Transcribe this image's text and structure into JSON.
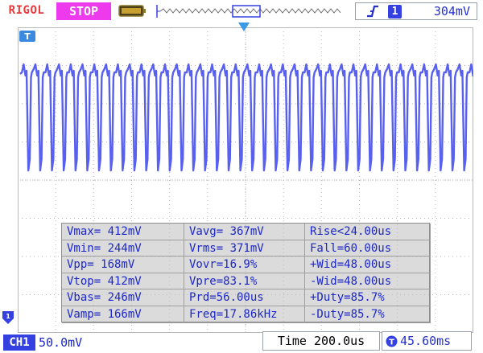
{
  "header": {
    "brand": "RIGOL",
    "run_state": "STOP"
  },
  "trigger": {
    "edge_icon": "rising-edge-icon",
    "source": "1",
    "level": "304mV"
  },
  "colors": {
    "channel": "#5860f0",
    "grid": "#b8b8b8",
    "brand": "#e8383a",
    "stop": "#ec3aec",
    "accent": "#3440e0"
  },
  "measurements": [
    [
      "Vmax= 412mV",
      "Vavg= 367mV",
      "Rise<24.00us"
    ],
    [
      "Vmin= 244mV",
      "Vrms= 371mV",
      "Fall=60.00us"
    ],
    [
      "Vpp= 168mV",
      "Vovr=16.9%",
      "+Wid=48.00us"
    ],
    [
      "Vtop= 412mV",
      "Vpre=83.1%",
      "-Wid=48.00us"
    ],
    [
      "Vbas= 246mV",
      "Prd=56.00us",
      "+Duty=85.7%"
    ],
    [
      "Vamp= 166mV",
      "Freq=17.86kHz",
      "-Duty=85.7%"
    ]
  ],
  "footer": {
    "channel_label": "CH1",
    "channel_scale": "50.0mV",
    "timebase": "Time 200.0us",
    "delay": "45.60ms"
  },
  "icons": [
    "battery-icon",
    "memory-depth-icon",
    "trigger-position-icon",
    "channel-marker-icon",
    "reference-marker-icon",
    "delay-icon"
  ]
}
